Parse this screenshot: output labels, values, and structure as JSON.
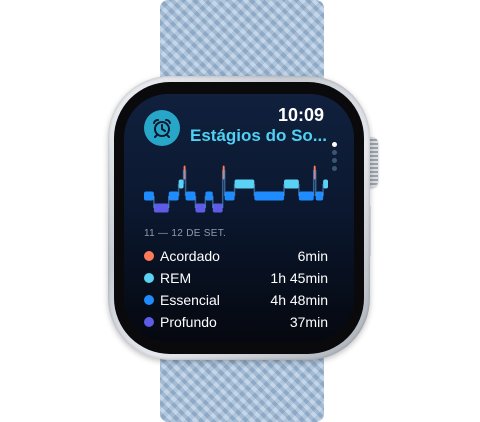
{
  "status": {
    "time": "10:09"
  },
  "app": {
    "title": "Estágios do So...",
    "icon": "alarm-clock-icon"
  },
  "pager": {
    "pages": 4,
    "current": 1
  },
  "date_range": "11 — 12 DE SET.",
  "colors": {
    "accent": "#4ed1f2",
    "awake": "#ff7a59",
    "rem": "#5ad2f4",
    "core": "#1e8bff",
    "deep": "#5e5ce6"
  },
  "stages": [
    {
      "name": "Acordado",
      "value": "6min",
      "color": "#ff7a59"
    },
    {
      "name": "REM",
      "value": "1h 45min",
      "color": "#5ad2f4"
    },
    {
      "name": "Essencial",
      "value": "4h 48min",
      "color": "#1e8bff"
    },
    {
      "name": "Profundo",
      "value": "37min",
      "color": "#5e5ce6"
    }
  ],
  "hypnogram": [
    {
      "stage": "core",
      "dur": 2
    },
    {
      "stage": "deep",
      "dur": 3
    },
    {
      "stage": "core",
      "dur": 2
    },
    {
      "stage": "rem",
      "dur": 1
    },
    {
      "stage": "awake",
      "dur": 0.4
    },
    {
      "stage": "core",
      "dur": 2
    },
    {
      "stage": "deep",
      "dur": 2
    },
    {
      "stage": "core",
      "dur": 1.5
    },
    {
      "stage": "deep",
      "dur": 2
    },
    {
      "stage": "awake",
      "dur": 0.4
    },
    {
      "stage": "core",
      "dur": 2
    },
    {
      "stage": "rem",
      "dur": 4
    },
    {
      "stage": "core",
      "dur": 6
    },
    {
      "stage": "rem",
      "dur": 3
    },
    {
      "stage": "core",
      "dur": 3
    },
    {
      "stage": "awake",
      "dur": 0.4
    },
    {
      "stage": "core",
      "dur": 1.5
    },
    {
      "stage": "rem",
      "dur": 1
    }
  ]
}
